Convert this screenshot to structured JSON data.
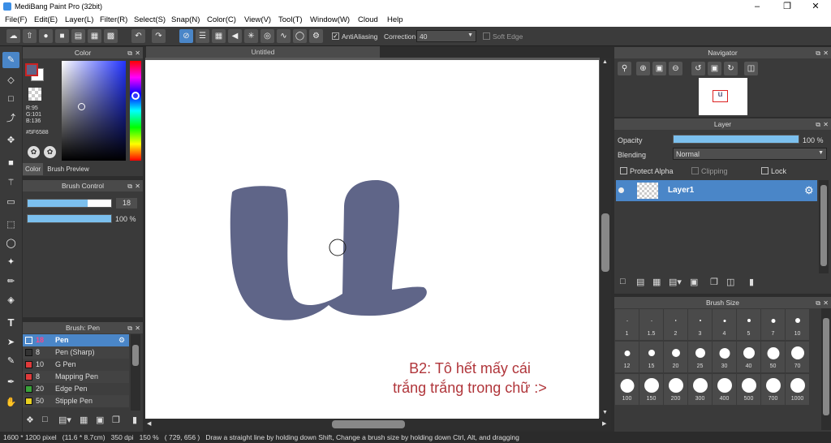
{
  "app": {
    "title": "MediBang Paint Pro (32bit)"
  },
  "menu": [
    "File(F)",
    "Edit(E)",
    "Layer(L)",
    "Filter(R)",
    "Select(S)",
    "Snap(N)",
    "Color(C)",
    "View(V)",
    "Tool(T)",
    "Window(W)",
    "Cloud",
    "Help"
  ],
  "toolbar": {
    "antialiasing": "AntiAliasing",
    "correction_label": "Correction",
    "correction_value": "40",
    "soft_edge": "Soft Edge"
  },
  "color_panel": {
    "title": "Color",
    "r": "R:95",
    "g": "G:101",
    "b": "B:136",
    "hex": "#5F6588",
    "tab_color": "Color",
    "tab_brush_preview": "Brush Preview",
    "fg": "#5F6588"
  },
  "brush_control": {
    "title": "Brush Control",
    "size": "18",
    "opacity": "100 %",
    "size_fraction": 0.72,
    "opacity_fraction": 1.0
  },
  "brush_list": {
    "title": "Brush: Pen",
    "items": [
      {
        "size": "18",
        "name": "Pen",
        "color": "#4a86c8",
        "selected": true
      },
      {
        "size": "8",
        "name": "Pen (Sharp)",
        "color": "#333333",
        "selected": false
      },
      {
        "size": "10",
        "name": "G Pen",
        "color": "#e03a3a",
        "selected": false
      },
      {
        "size": "8",
        "name": "Mapping Pen",
        "color": "#e03a3a",
        "selected": false
      },
      {
        "size": "20",
        "name": "Edge Pen",
        "color": "#3aa33a",
        "selected": false
      },
      {
        "size": "50",
        "name": "Stipple Pen",
        "color": "#e8d020",
        "selected": false
      }
    ]
  },
  "document": {
    "tab": "Untitled",
    "annotation_line1": "B2: Tô hết mấy cái",
    "annotation_line2": "trắng trắng trong chữ :>",
    "stroke_color": "#5F6588",
    "annotation_color": "#b0353a"
  },
  "navigator": {
    "title": "Navigator",
    "thumb_text": "u"
  },
  "layer_panel": {
    "title": "Layer",
    "opacity_label": "Opacity",
    "opacity_value": "100 %",
    "blending_label": "Blending",
    "blending_value": "Normal",
    "protect_alpha": "Protect Alpha",
    "clipping": "Clipping",
    "lock": "Lock",
    "layer_name": "Layer1"
  },
  "brush_size": {
    "title": "Brush Size",
    "row1": [
      "1",
      "1.5",
      "2",
      "3",
      "4",
      "5",
      "7",
      "10"
    ],
    "row2": [
      "12",
      "15",
      "20",
      "25",
      "30",
      "40",
      "50",
      "70"
    ],
    "row3": [
      "100",
      "150",
      "200",
      "300",
      "400",
      "500",
      "700",
      "1000"
    ]
  },
  "status": {
    "text": "1600 * 1200 pixel   (11.6 * 8.7cm)   350 dpi   150 %   ( 729, 656 )   Draw a straight line by holding down Shift, Change a brush size by holding down Ctrl, Alt, and dragging"
  }
}
